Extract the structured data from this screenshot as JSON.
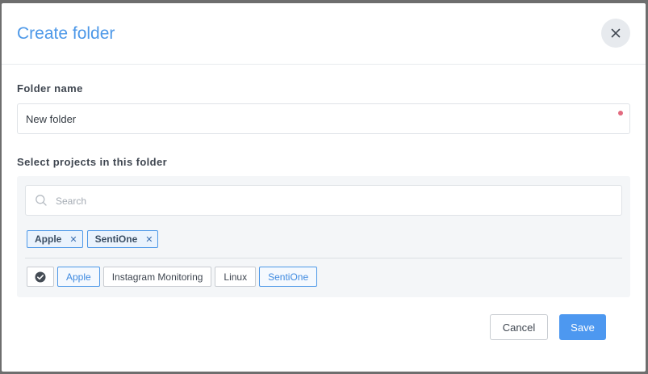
{
  "dialog": {
    "title": "Create folder",
    "close_icon": "close-icon"
  },
  "folder_name": {
    "label": "Folder name",
    "value": "New folder"
  },
  "projects": {
    "label": "Select projects in this folder",
    "search": {
      "placeholder": "Search",
      "icon": "search-icon"
    },
    "selected": [
      {
        "label": "Apple"
      },
      {
        "label": "SentiOne"
      }
    ],
    "select_all_icon": "check-circle-icon",
    "options": [
      {
        "label": "Apple",
        "selected": true
      },
      {
        "label": "Instagram Monitoring",
        "selected": false
      },
      {
        "label": "Linux",
        "selected": false
      },
      {
        "label": "SentiOne",
        "selected": true
      }
    ]
  },
  "actions": {
    "cancel_label": "Cancel",
    "save_label": "Save"
  },
  "colors": {
    "accent": "#4d98e8",
    "required_dot": "#e26a7f",
    "panel_bg": "#f4f6f8"
  }
}
